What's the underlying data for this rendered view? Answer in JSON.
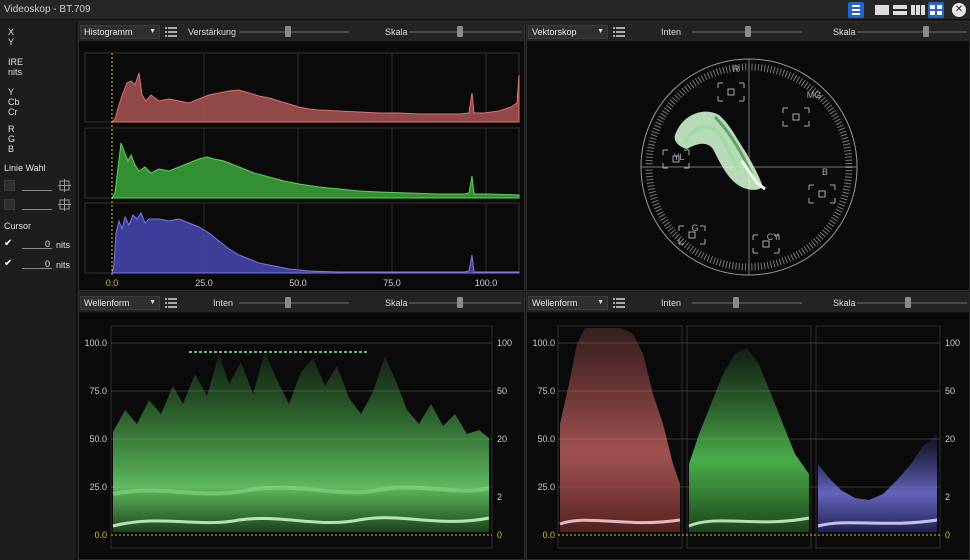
{
  "window": {
    "title": "Videoskop - BT.709"
  },
  "sidebar": {
    "xy": [
      "X",
      "Y"
    ],
    "ire": [
      "IRE",
      "nits"
    ],
    "ycbcr": [
      "Y",
      "Cb",
      "Cr"
    ],
    "rgb": [
      "R",
      "G",
      "B"
    ],
    "line_select_label": "Linie Wahl",
    "cursor_label": "Cursor",
    "cursor_rows": [
      {
        "value": "0",
        "unit": "nits"
      },
      {
        "value": "0",
        "unit": "nits"
      }
    ]
  },
  "panels": {
    "histogram": {
      "mode": "Histogramm",
      "slider1_label": "Verstärkung",
      "slider2_label": "Skala",
      "x_ticks": [
        "0.0",
        "25.0",
        "50.0",
        "75.0",
        "100.0"
      ]
    },
    "vectorscope": {
      "mode": "Vektorskop",
      "slider1_label": "Inten",
      "slider2_label": "Skala",
      "targets": [
        "R",
        "MG",
        "B",
        "CY",
        "G",
        "YL"
      ]
    },
    "waveform_luma": {
      "mode": "Wellenform",
      "slider1_label": "Inten",
      "slider2_label": "Skala",
      "left_ticks": [
        "100.0",
        "75.0",
        "50.0",
        "25.0",
        "0.0"
      ],
      "right_ticks": [
        "100",
        "50",
        "20",
        "2",
        "0"
      ]
    },
    "waveform_rgb": {
      "mode": "Wellenform",
      "slider1_label": "Inten",
      "slider2_label": "Skala",
      "left_ticks": [
        "100.0",
        "75.0",
        "50.0",
        "25.0",
        "0.0"
      ],
      "right_ticks": [
        "100",
        "50",
        "20",
        "2",
        "0"
      ]
    }
  },
  "colors": {
    "red_trace": "#e07070",
    "green_trace": "#5cd45c",
    "blue_trace": "#7a7ae6",
    "accent": "#2563c9",
    "zero_line": "#d4c020"
  }
}
